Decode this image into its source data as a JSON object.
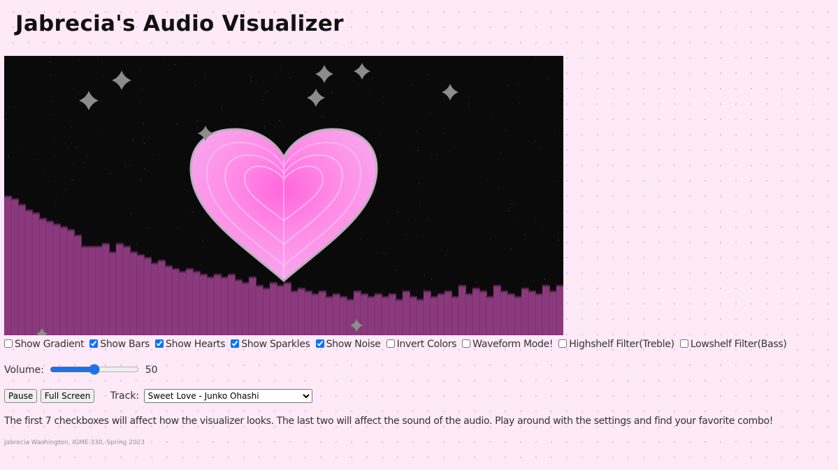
{
  "page": {
    "title": "Jabrecia's Audio Visualizer"
  },
  "checkboxes": [
    {
      "label": "Show Gradient",
      "checked": false
    },
    {
      "label": "Show Bars",
      "checked": true
    },
    {
      "label": "Show Hearts",
      "checked": true
    },
    {
      "label": "Show Sparkles",
      "checked": true
    },
    {
      "label": "Show Noise",
      "checked": true
    },
    {
      "label": "Invert Colors",
      "checked": false
    },
    {
      "label": "Waveform Mode!",
      "checked": false
    },
    {
      "label": "Highshelf Filter(Treble)",
      "checked": false
    },
    {
      "label": "Lowshelf Filter(Bass)",
      "checked": false
    }
  ],
  "volume": {
    "label": "Volume:",
    "value": 50,
    "display": "50"
  },
  "buttons": {
    "pause": "Pause",
    "fullscreen": "Full Screen"
  },
  "track": {
    "label": "Track:",
    "selected": "Sweet Love - Junko Ohashi"
  },
  "instructions": "The first 7 checkboxes will affect how the visualizer looks. The last two will affect the sound of the audio. Play around with the settings and find your favorite combo!",
  "credit": "Jabrecia Washington, IGME 330, Spring 2023",
  "visualizer": {
    "background_color": "#0a0a0a",
    "bar_color": "#8a3a7c",
    "heart_color": "#ff7ee0",
    "sparkle_color": "#8c8c8c",
    "bar_levels": [
      0.5,
      0.49,
      0.47,
      0.45,
      0.44,
      0.42,
      0.41,
      0.4,
      0.39,
      0.38,
      0.36,
      0.32,
      0.32,
      0.32,
      0.33,
      0.3,
      0.33,
      0.32,
      0.3,
      0.29,
      0.28,
      0.26,
      0.27,
      0.25,
      0.24,
      0.23,
      0.24,
      0.23,
      0.22,
      0.21,
      0.22,
      0.21,
      0.22,
      0.2,
      0.19,
      0.21,
      0.18,
      0.17,
      0.19,
      0.18,
      0.19,
      0.16,
      0.17,
      0.16,
      0.15,
      0.16,
      0.14,
      0.15,
      0.14,
      0.13,
      0.16,
      0.15,
      0.14,
      0.15,
      0.14,
      0.15,
      0.13,
      0.16,
      0.14,
      0.13,
      0.16,
      0.14,
      0.15,
      0.16,
      0.14,
      0.18,
      0.15,
      0.17,
      0.16,
      0.14,
      0.18,
      0.16,
      0.15,
      0.14,
      0.17,
      0.16,
      0.15,
      0.18,
      0.16,
      0.18
    ]
  }
}
